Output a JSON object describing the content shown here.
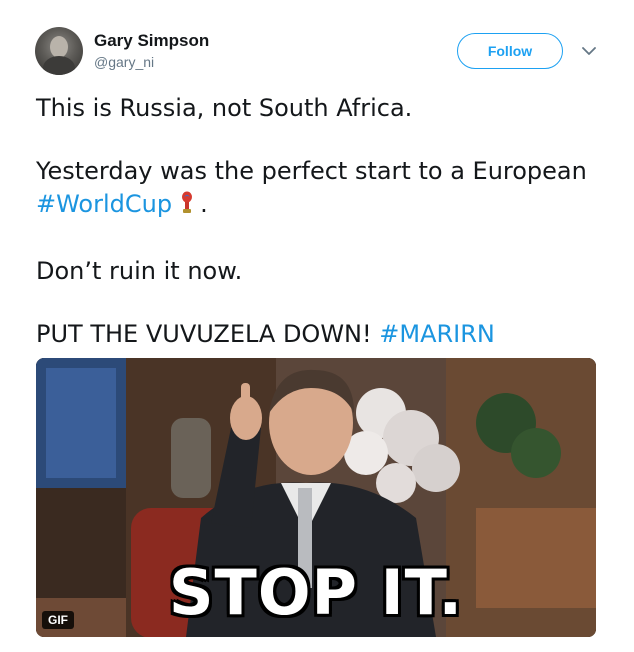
{
  "user": {
    "name": "Gary Simpson",
    "handle": "@gary_ni"
  },
  "actions": {
    "follow_label": "Follow"
  },
  "icons": {
    "more": "chevron-down-icon",
    "emoji": "world-cup-trophy-icon"
  },
  "tweet": {
    "line1": "This is Russia, not South Africa.",
    "line2_text": "Yesterday was the perfect start to a European",
    "line2_hashtag": "#WorldCup",
    "line2_suffix": ".",
    "line3": "Don’t ruin it now.",
    "line4_text": "PUT THE VUVUZELA DOWN!",
    "line4_hashtag": "#MARIRN"
  },
  "media": {
    "caption": "STOP IT.",
    "badge": "GIF"
  },
  "colors": {
    "accent": "#1da1f2",
    "hashtag": "#1b95e0",
    "text": "#14171a",
    "secondary": "#657786"
  }
}
